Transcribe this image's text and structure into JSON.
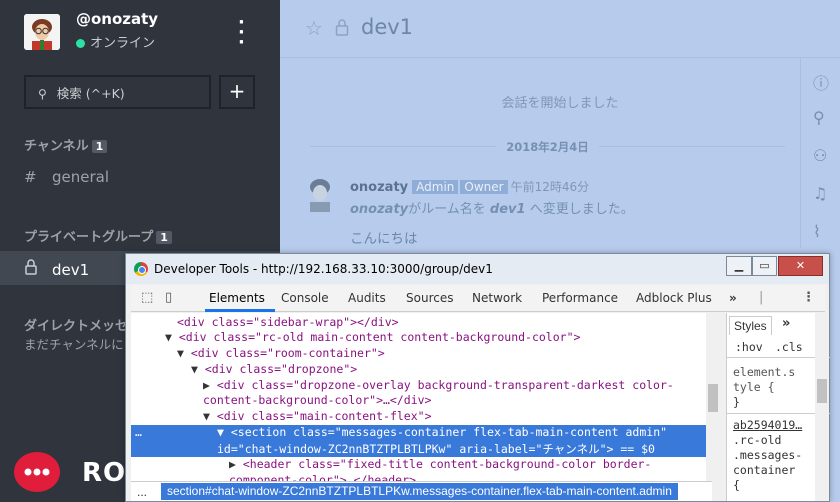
{
  "sidebar": {
    "username": "@onozaty",
    "status": "オンライン",
    "search_placeholder": "検索 (^+K)",
    "channels_title": "チャンネル",
    "channels_count": "1",
    "channels": [
      {
        "name": "general"
      }
    ],
    "private_title": "プライベートグループ",
    "private_count": "1",
    "private": [
      {
        "name": "dev1"
      }
    ],
    "direct_title": "ダイレクトメッセ",
    "direct_empty": "まだチャンネルに",
    "logo_text": "RO"
  },
  "main": {
    "room_name": "dev1",
    "system_message": "会話を開始しました",
    "date": "2018年2月4日",
    "message": {
      "author": "onozaty",
      "badges": [
        "Admin",
        "Owner"
      ],
      "time": "午前12時46分",
      "body_user": "onozaty",
      "body_mid": "がルーム名を",
      "body_room": "dev1",
      "body_end": " へ変更しました。",
      "second": "こんにちは"
    },
    "rightbar_icons": [
      "info-icon",
      "search-icon",
      "members-icon",
      "bell-icon",
      "paperclip-icon"
    ]
  },
  "devtools": {
    "title": "Developer Tools - http://192.168.33.10:3000/group/dev1",
    "tabs": [
      "Elements",
      "Console",
      "Audits",
      "Sources",
      "Network",
      "Performance",
      "Adblock Plus"
    ],
    "active_tab": "Elements",
    "more": "»",
    "dom": {
      "l1": "<div class=\"sidebar-wrap\"></div>",
      "l2": "<div class=\"rc-old main-content content-background-color\">",
      "l3": "<div class=\"room-container\">",
      "l4": "<div class=\"dropzone\">",
      "l5a": "<div class=\"dropzone-overlay background-transparent-darkest color-",
      "l5b": "content-background-color\">…</div>",
      "l6": "<div class=\"main-content-flex\">",
      "l7a": "<section class=\"messages-container flex-tab-main-content admin\"",
      "l7b": "id=\"chat-window-ZC2nnBTZTPLBTLPKw\" aria-label=\"チャンネル\"> == $0",
      "l8a": "<header class=\"fixed-title content-background-color border-",
      "l8b": "component-color\">…</header>"
    },
    "breadcrumb_dots": "...",
    "breadcrumb": "section#chat-window-ZC2nnBTZTPLBTLPKw.messages-container.flex-tab-main-content.admin",
    "styles_tab": "Styles",
    "styles": {
      "hov": ":hov",
      "cls": ".cls",
      "el1": "element.s",
      "el2": "tyle {",
      "el3": "}",
      "link": "ab2594019…",
      "sel1": ".rc-old",
      "sel2": ".messages-",
      "sel3": "container",
      "sel4": "{"
    }
  }
}
